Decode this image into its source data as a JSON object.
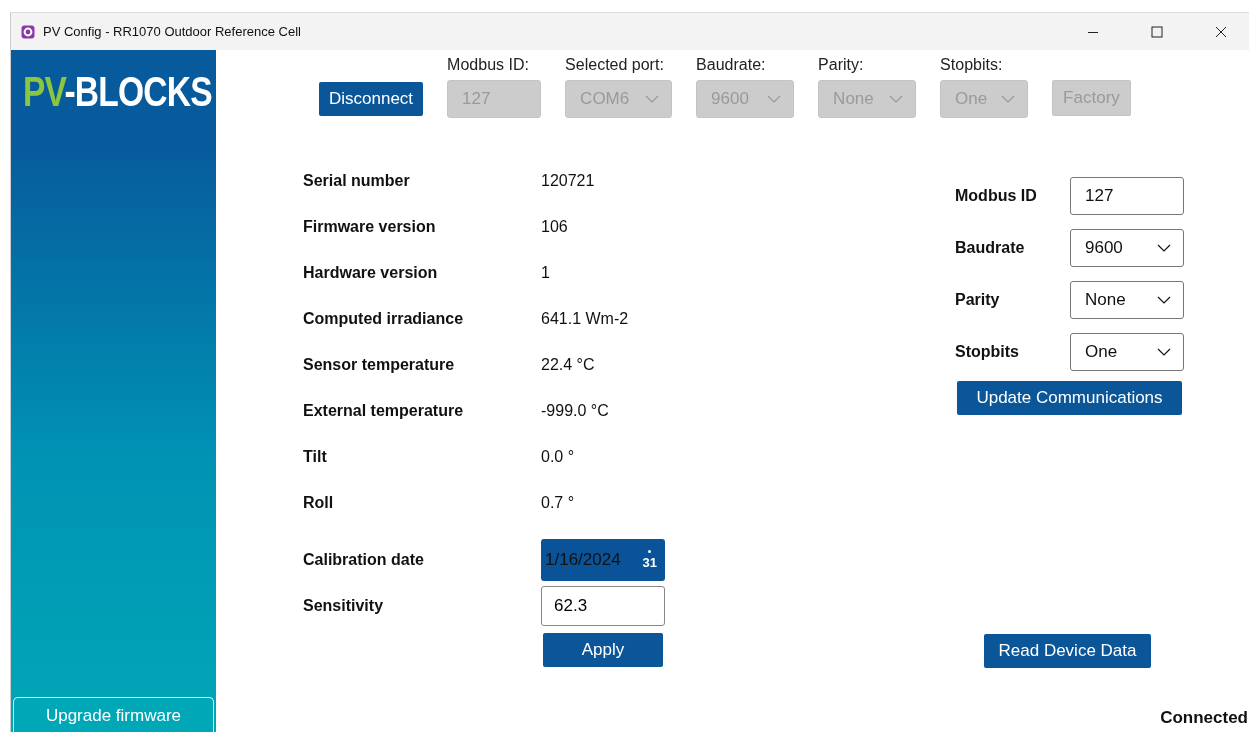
{
  "window": {
    "title": "PV Config - RR1070 Outdoor Reference Cell"
  },
  "sidebar": {
    "logo": {
      "prefix": "PV",
      "suffix": "-BLOCKS"
    },
    "upgrade_button": "Upgrade firmware"
  },
  "toolbar": {
    "connect_button": "Disconnect",
    "fields": [
      {
        "kind": "input",
        "label": "Modbus ID:",
        "value": "127",
        "disabled": true
      },
      {
        "kind": "dropdown",
        "label": "Selected port:",
        "value": "COM6",
        "disabled": true
      },
      {
        "kind": "dropdown",
        "label": "Baudrate:",
        "value": "9600",
        "disabled": true
      },
      {
        "kind": "dropdown",
        "label": "Parity:",
        "value": "None",
        "disabled": true
      },
      {
        "kind": "dropdown",
        "label": "Stopbits:",
        "value": "One",
        "disabled": true
      }
    ],
    "factory_button": {
      "label": "Factory",
      "disabled": true
    }
  },
  "device_info": [
    {
      "label": "Serial number",
      "value": "120721"
    },
    {
      "label": "Firmware version",
      "value": "106"
    },
    {
      "label": "Hardware version",
      "value": "1"
    },
    {
      "label": "Computed irradiance",
      "value": "641.1 Wm-2"
    },
    {
      "label": "Sensor temperature",
      "value": "22.4 °C"
    },
    {
      "label": "External temperature",
      "value": "-999.0 °C"
    },
    {
      "label": "Tilt",
      "value": "0.0 °"
    },
    {
      "label": "Roll",
      "value": "0.7 °"
    }
  ],
  "calibration": {
    "date_label": "Calibration date",
    "date_value": "1/16/2024",
    "calendar_icon": "31",
    "sensitivity_label": "Sensitivity",
    "sensitivity_value": "62.3",
    "apply_button": "Apply"
  },
  "communications": {
    "fields": [
      {
        "kind": "input",
        "label": "Modbus ID",
        "value": "127"
      },
      {
        "kind": "dropdown",
        "label": "Baudrate",
        "value": "9600"
      },
      {
        "kind": "dropdown",
        "label": "Parity",
        "value": "None"
      },
      {
        "kind": "dropdown",
        "label": "Stopbits",
        "value": "One"
      }
    ],
    "update_button": "Update Communications"
  },
  "read_button": "Read Device Data",
  "status": "Connected"
}
